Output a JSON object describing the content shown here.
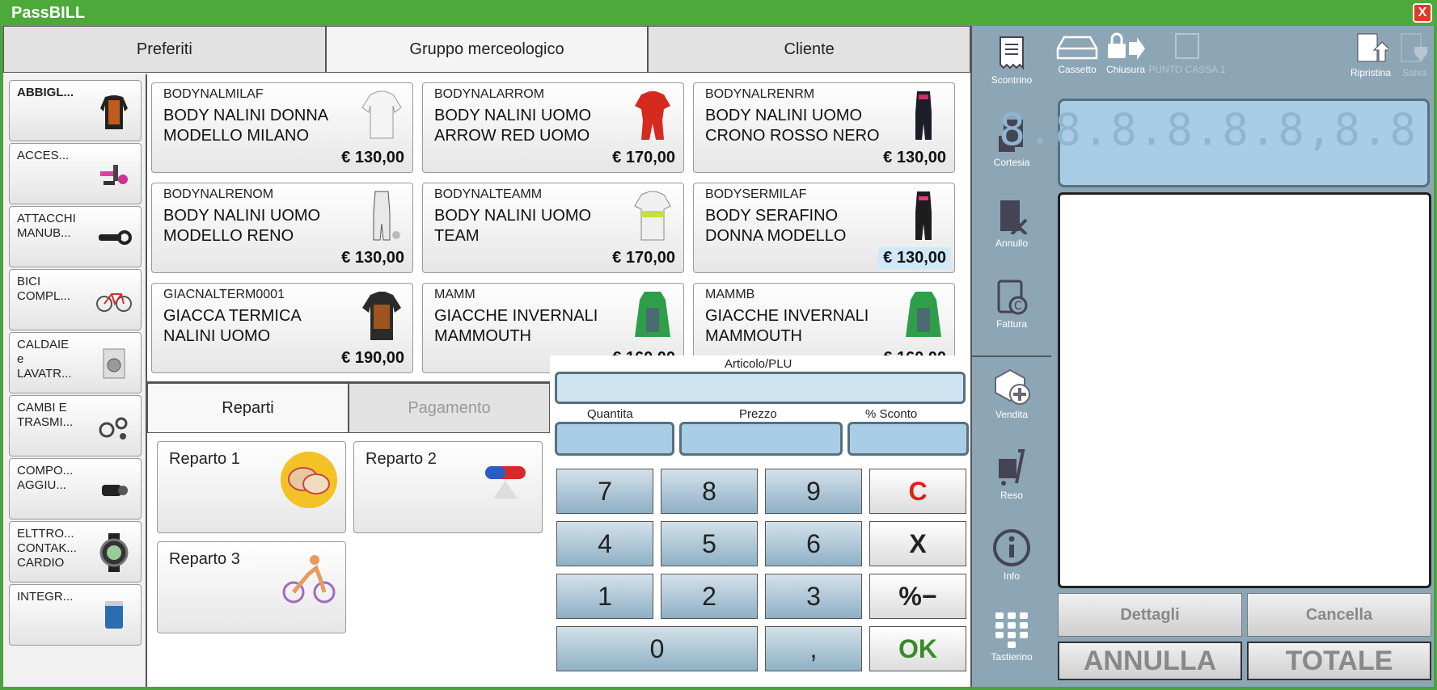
{
  "window": {
    "title": "PassBILL",
    "close_label": "X"
  },
  "top_tabs": [
    {
      "label": "Preferiti",
      "active": false
    },
    {
      "label": "Gruppo merceologico",
      "active": true
    },
    {
      "label": "Cliente",
      "active": false
    }
  ],
  "categories": [
    {
      "label": "ABBIGL...",
      "selected": true
    },
    {
      "label": "ACCES...",
      "selected": false
    },
    {
      "label": "ATTACCHI\nMANUB...",
      "selected": false
    },
    {
      "label": "BICI\nCOMPL...",
      "selected": false
    },
    {
      "label": "CALDAIE\ne\nLAVATR...",
      "selected": false
    },
    {
      "label": "CAMBI E\nTRASMI...",
      "selected": false
    },
    {
      "label": "COMPO...\nAGGIU...",
      "selected": false
    },
    {
      "label": "ELTTRO...\nCONTAK...\nCARDIO",
      "selected": false
    },
    {
      "label": "INTEGR...",
      "selected": false
    }
  ],
  "products": [
    {
      "code": "BODYNALMILAF",
      "name": "BODY NALINI DONNA MODELLO MILANO",
      "price": "€ 130,00",
      "highlight": false
    },
    {
      "code": "BODYNALARROM",
      "name": "BODY NALINI UOMO ARROW RED UOMO",
      "price": "€ 170,00",
      "highlight": false
    },
    {
      "code": "BODYNALRENRM",
      "name": "BODY NALINI UOMO CRONO ROSSO NERO",
      "price": "€ 130,00",
      "highlight": false
    },
    {
      "code": "BODYNALRENOM",
      "name": "BODY NALINI UOMO MODELLO RENO",
      "price": "€ 130,00",
      "highlight": false
    },
    {
      "code": "BODYNALTEAMM",
      "name": "BODY NALINI UOMO TEAM",
      "price": "€ 170,00",
      "highlight": false
    },
    {
      "code": "BODYSERMILAF",
      "name": "BODY SERAFINO DONNA MODELLO",
      "price": "€ 130,00",
      "highlight": true
    },
    {
      "code": "GIACNALTERM0001",
      "name": "GIACCA TERMICA NALINI UOMO",
      "price": "€ 190,00",
      "highlight": false
    },
    {
      "code": "MAMM",
      "name": "GIACCHE INVERNALI MAMMOUTH",
      "price": "€ 160,00",
      "highlight": false
    },
    {
      "code": "MAMMB",
      "name": "GIACCHE INVERNALI MAMMOUTH",
      "price": "€ 160,00",
      "highlight": false
    }
  ],
  "rep_tabs": [
    {
      "label": "Reparti",
      "active": true
    },
    {
      "label": "Pagamento",
      "active": false
    }
  ],
  "reparti": [
    {
      "label": "Reparto 1"
    },
    {
      "label": "Reparto 2"
    },
    {
      "label": "Reparto 3"
    }
  ],
  "fields": {
    "articolo": "Articolo/PLU",
    "quantita": "Quantita",
    "prezzo": "Prezzo",
    "sconto": "% Sconto"
  },
  "keypad": {
    "k7": "7",
    "k8": "8",
    "k9": "9",
    "kc": "C",
    "k4": "4",
    "k5": "5",
    "k6": "6",
    "kx": "X",
    "k1": "1",
    "k2": "2",
    "k3": "3",
    "kpct": "%−",
    "k0": "0",
    "kcomma": ",",
    "kok": "OK"
  },
  "side_buttons": {
    "scontrino": "Scontrino",
    "cortesia": "Cortesia",
    "annullo": "Annullo",
    "fattura": "Fattura",
    "vendita": "Vendita",
    "reso": "Reso",
    "info": "Info",
    "tastierino": "Tastierino"
  },
  "toolbar": {
    "cassetto": "Cassetto",
    "chiusura": "Chiusura",
    "punto_cassa": "PUNTO CASSA 1",
    "ripristina": "Ripristina",
    "salva": "Salva"
  },
  "display": {
    "value": "8.8.8.8.8.8,8.8"
  },
  "actions": {
    "dettagli": "Dettagli",
    "cancella": "Cancella",
    "annulla": "ANNULLA",
    "totale": "TOTALE"
  }
}
